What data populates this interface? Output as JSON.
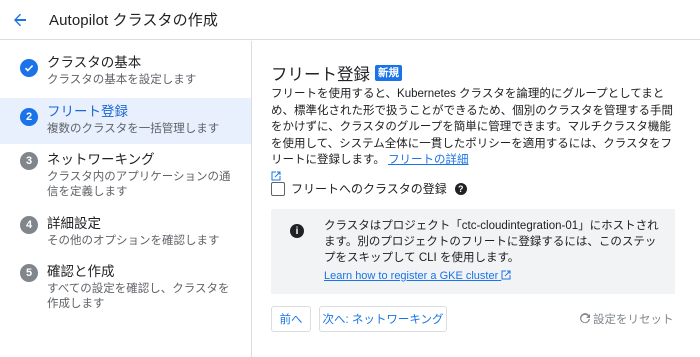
{
  "header": {
    "title": "Autopilot クラスタの作成",
    "back_icon": "arrow-back-icon"
  },
  "sidebar": {
    "steps": [
      {
        "number": "✓",
        "state": "done",
        "title": "クラスタの基本",
        "desc": "クラスタの基本を設定します"
      },
      {
        "number": "2",
        "state": "current",
        "title": "フリート登録",
        "desc": "複数のクラスタを一括管理します"
      },
      {
        "number": "3",
        "state": "todo",
        "title": "ネットワーキング",
        "desc": "クラスタ内のアプリケーションの通信を定義します"
      },
      {
        "number": "4",
        "state": "todo",
        "title": "詳細設定",
        "desc": "その他のオプションを確認します"
      },
      {
        "number": "5",
        "state": "todo",
        "title": "確認と作成",
        "desc": "すべての設定を確認し、クラスタを作成します"
      }
    ]
  },
  "main": {
    "title": "フリート登録",
    "badge": "新規",
    "description": "フリートを使用すると、Kubernetes クラスタを論理的にグループとしてまとめ、標準化された形で扱うことができるため、個別のクラスタを管理する手間をかけずに、クラスタのグループを簡単に管理できます。マルチクラスタ機能を使用して、システム全体に一貫したポリシーを適用するには、クラスタをフリートに登録します。",
    "description_link": "フリートの詳細",
    "checkbox_label": "フリートへのクラスタの登録",
    "checkbox_checked": false,
    "info": {
      "text": "クラスタはプロジェクト「ctc-cloudintegration-01」にホストされます。別のプロジェクトのフリートに登録するには、このステップをスキップして CLI を使用します。",
      "link": "Learn how to register a GKE cluster"
    },
    "buttons": {
      "prev": "前へ",
      "next": "次へ: ネットワーキング",
      "reset": "設定をリセット"
    }
  },
  "colors": {
    "accent": "#1a73e8",
    "active_bg": "#e8f0fe",
    "muted": "#80868b",
    "info_bg": "#f1f3f4"
  }
}
